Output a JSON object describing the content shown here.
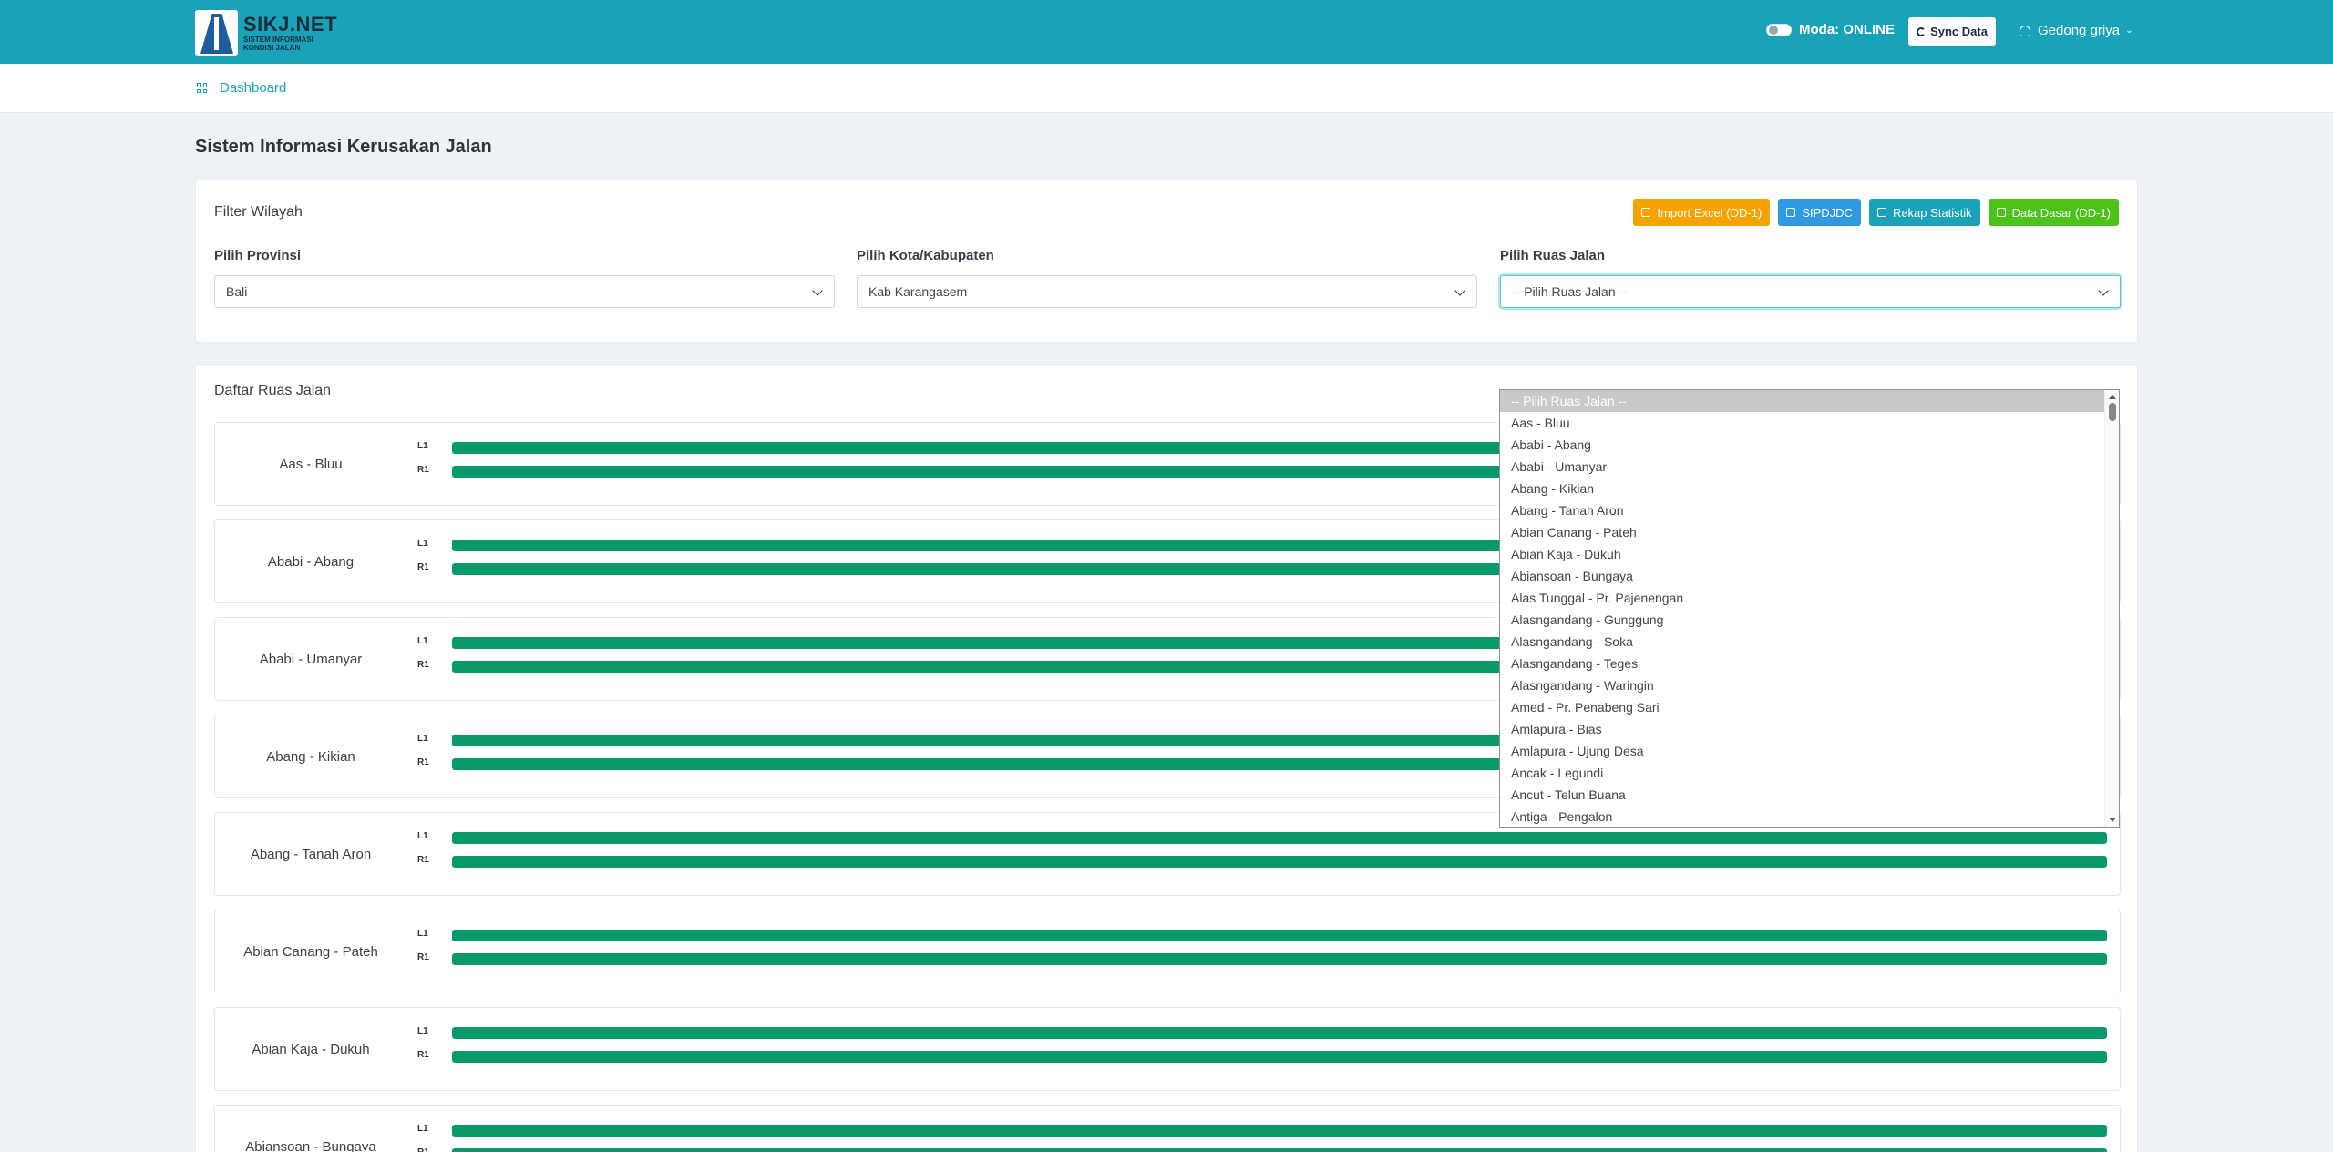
{
  "header": {
    "logo_title": "SIKJ.NET",
    "logo_sub_1": "SISTEM INFORMASI",
    "logo_sub_2": "KONDISI JALAN",
    "mode_label": "Moda: ONLINE",
    "sync_label": "Sync Data",
    "user_name": "Gedong griya"
  },
  "breadcrumb": {
    "label": "Dashboard"
  },
  "page_title": "Sistem Informasi Kerusakan Jalan",
  "filter": {
    "title": "Filter Wilayah",
    "buttons": {
      "import": "Import Excel (DD-1)",
      "sipdjdc": "SIPDJDC",
      "rekap": "Rekap Statistik",
      "data_dasar": "Data Dasar (DD-1)"
    },
    "provinsi": {
      "label": "Pilih Provinsi",
      "value": "Bali"
    },
    "kota": {
      "label": "Pilih Kota/Kabupaten",
      "value": "Kab Karangasem"
    },
    "ruas": {
      "label": "Pilih Ruas Jalan",
      "value": "-- Pilih Ruas Jalan --"
    }
  },
  "list": {
    "title": "Daftar Ruas Jalan",
    "lane_left": "L1",
    "lane_right": "R1",
    "rows": [
      "Aas - Bluu",
      "Ababi - Abang",
      "Ababi - Umanyar",
      "Abang - Kikian",
      "Abang - Tanah Aron",
      "Abian Canang - Pateh",
      "Abian Kaja - Dukuh",
      "Abiansoan - Bungaya"
    ]
  },
  "dropdown_options": [
    "-- Pilih Ruas Jalan --",
    "Aas - Bluu",
    "Ababi - Abang",
    "Ababi - Umanyar",
    "Abang - Kikian",
    "Abang - Tanah Aron",
    "Abian Canang - Pateh",
    "Abian Kaja - Dukuh",
    "Abiansoan - Bungaya",
    "Alas Tunggal - Pr. Pajenengan",
    "Alasngandang - Gunggung",
    "Alasngandang - Soka",
    "Alasngandang - Teges",
    "Alasngandang - Waringin",
    "Amed - Pr. Penabeng Sari",
    "Amlapura - Bias",
    "Amlapura - Ujung Desa",
    "Ancak - Legundi",
    "Ancut - Telun Buana",
    "Antiga - Pengalon"
  ],
  "colors": {
    "header_bg": "#1aa3b8",
    "bar_good": "#0a9a68",
    "btn_orange": "#f4a300",
    "btn_blue": "#2f9ae0",
    "btn_teal": "#1aa3b8",
    "btn_green": "#4cc31a"
  }
}
